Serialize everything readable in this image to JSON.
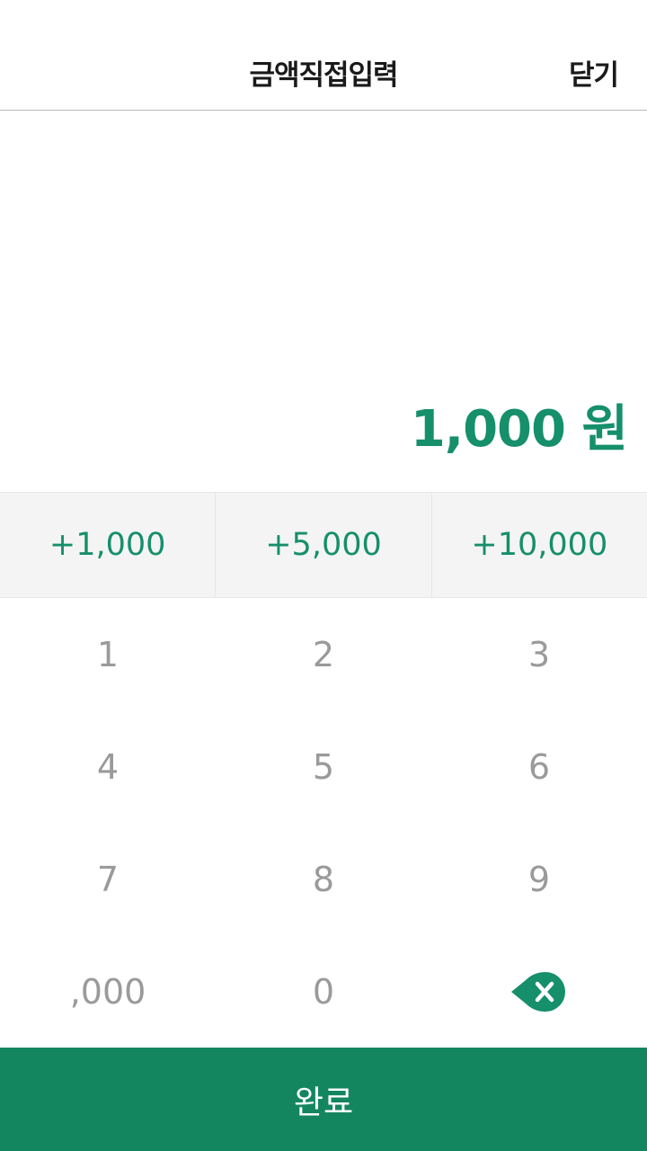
{
  "header": {
    "title": "금액직접입력",
    "close_label": "닫기"
  },
  "amount": {
    "display": "1,000 원"
  },
  "quick_add": [
    {
      "label": "+1,000"
    },
    {
      "label": "+5,000"
    },
    {
      "label": "+10,000"
    }
  ],
  "keypad": {
    "keys": [
      "1",
      "2",
      "3",
      "4",
      "5",
      "6",
      "7",
      "8",
      "9",
      ",000",
      "0"
    ],
    "backspace_icon": "backspace-icon"
  },
  "footer": {
    "done_label": "완료"
  },
  "colors": {
    "accent": "#168f6b",
    "done_background": "#14865f",
    "keypad_text": "#9a9a9a",
    "quick_bar_background": "#f4f4f4"
  }
}
